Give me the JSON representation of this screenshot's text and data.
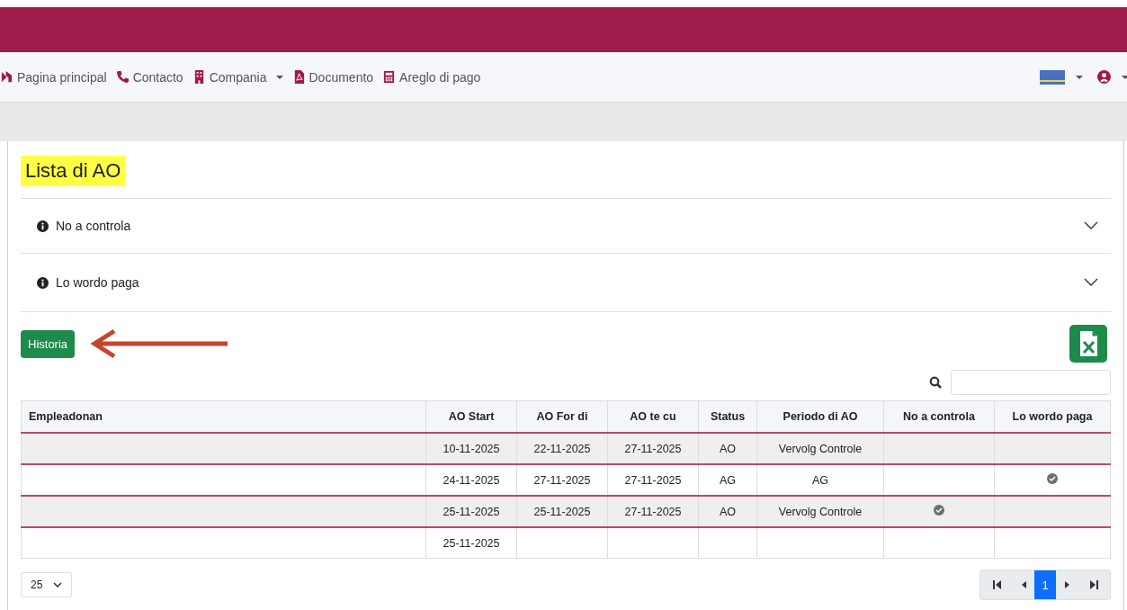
{
  "nav": {
    "items": [
      {
        "label": "Pagina principal",
        "dropdown": false
      },
      {
        "label": "Contacto",
        "dropdown": false
      },
      {
        "label": "Compania",
        "dropdown": true
      },
      {
        "label": "Documento",
        "dropdown": false
      },
      {
        "label": "Areglo di pago",
        "dropdown": false
      }
    ]
  },
  "page": {
    "title": "Lista di AO"
  },
  "accordions": [
    {
      "label": "No a controla",
      "expanded": false
    },
    {
      "label": "Lo wordo paga",
      "expanded": false
    }
  ],
  "history_button": "Historia",
  "table": {
    "columns": [
      "Empleadonan",
      "AO Start",
      "AO For di",
      "AO te cu",
      "Status",
      "Periodo di AO",
      "No a controla",
      "Lo wordo paga"
    ],
    "rows": [
      {
        "cells": [
          "",
          "10-11-2025",
          "22-11-2025",
          "27-11-2025",
          "AO",
          "Vervolg Controle"
        ],
        "no_a_controla": false,
        "lo_wordo_paga": false
      },
      {
        "cells": [
          "",
          "24-11-2025",
          "27-11-2025",
          "27-11-2025",
          "AG",
          "AG"
        ],
        "no_a_controla": false,
        "lo_wordo_paga": true
      },
      {
        "cells": [
          "",
          "25-11-2025",
          "25-11-2025",
          "27-11-2025",
          "AO",
          "Vervolg Controle"
        ],
        "no_a_controla": true,
        "lo_wordo_paga": false
      },
      {
        "cells": [
          "",
          "25-11-2025",
          "",
          "",
          "",
          ""
        ],
        "no_a_controla": false,
        "lo_wordo_paga": false
      }
    ]
  },
  "page_size": "25",
  "pagination": {
    "pages": [
      {
        "label": "1",
        "selected": true
      }
    ]
  }
}
